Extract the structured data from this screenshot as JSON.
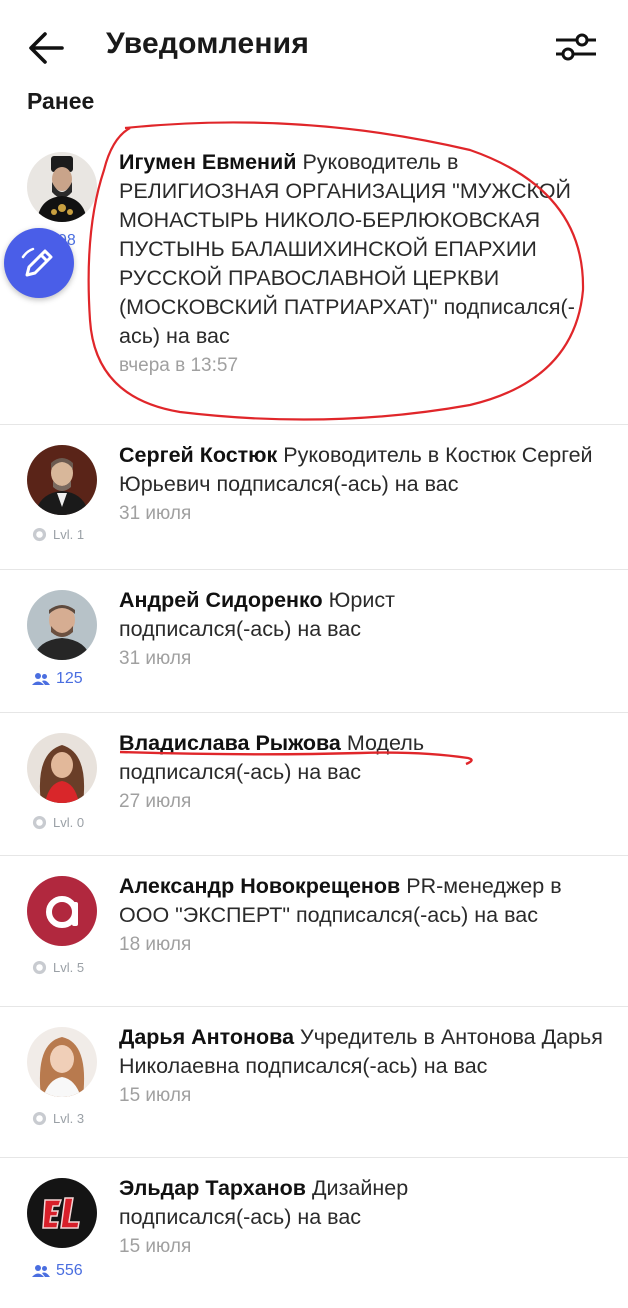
{
  "header": {
    "title": "Уведомления",
    "back_icon": "arrow-left-icon",
    "filter_icon": "sliders-icon"
  },
  "section": {
    "title": "Ранее"
  },
  "notifications": [
    {
      "name": "Игумен Евмений",
      "role": "Руководитель в РЕЛИГИОЗНАЯ ОРГАНИЗАЦИЯ \"МУЖСКОЙ МОНАСТЫРЬ НИКОЛО-БЕРЛЮКОВСКАЯ ПУСТЫНЬ БАЛАШИХИНСКОЙ ЕПАРХИИ РУССКОЙ ПРАВОСЛАВНОЙ ЦЕРКВИ (МОСКОВСКИЙ ПАТРИАРХАТ)\"",
      "action": "подписался(-ась) на вас",
      "time": "вчера в 13:57",
      "badge": "98"
    },
    {
      "name": "Сергей Костюк",
      "role": "Руководитель в Костюк Сергей Юрьевич",
      "action": "подписался(-ась) на вас",
      "time": "31 июля",
      "badge": "Lvl. 1"
    },
    {
      "name": "Андрей Сидоренко",
      "role": "Юрист",
      "action": "подписался(-ась) на вас",
      "time": "31 июля",
      "badge": "125"
    },
    {
      "name": "Владислава Рыжова",
      "role": "Модель",
      "action": "подписался(-ась) на вас",
      "time": "27 июля",
      "badge": "Lvl. 0"
    },
    {
      "name": "Александр Новокрещенов",
      "role": "PR-менеджер в ООО \"ЭКСПЕРТ\"",
      "action": "подписался(-ась) на вас",
      "time": "18 июля",
      "badge": "Lvl. 5"
    },
    {
      "name": "Дарья Антонова",
      "role": "Учредитель в Антонова Дарья Николаевна",
      "action": "подписался(-ась) на вас",
      "time": "15 июля",
      "badge": "Lvl. 3"
    },
    {
      "name": "Эльдар Тарханов",
      "role": "Дизайнер",
      "action": "подписался(-ась) на вас",
      "time": "15 июля",
      "badge": "556"
    }
  ],
  "colors": {
    "accent": "#4a5ee8",
    "annotation": "#e0262a",
    "muted": "#a0a0a0"
  }
}
